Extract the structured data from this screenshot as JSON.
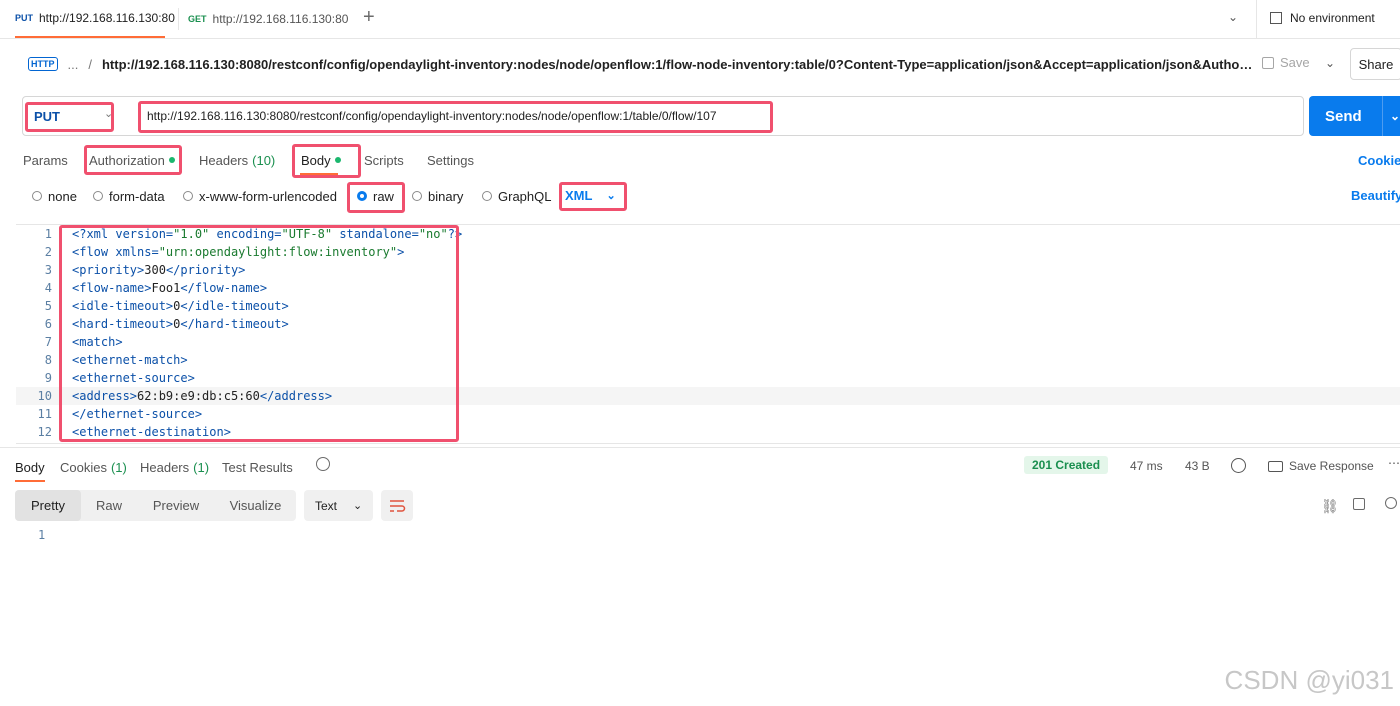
{
  "tabs": [
    {
      "method": "PUT",
      "url": "http://192.168.116.130:80"
    },
    {
      "method": "GET",
      "url": "http://192.168.116.130:80"
    }
  ],
  "environment": "No environment",
  "request_title": "http://192.168.116.130:8080/restconf/config/opendaylight-inventory:nodes/node/openflow:1/flow-node-inventory:table/0?Content-Type=application/json&Accept=application/json&Autho…",
  "breadcrumb_dots": "...",
  "breadcrumb_sep": "/",
  "http_badge": "HTTP",
  "save_label": "Save",
  "share_label": "Share",
  "method": "PUT",
  "url": "http://192.168.116.130:8080/restconf/config/opendaylight-inventory:nodes/node/openflow:1/table/0/flow/107",
  "send_label": "Send",
  "subtabs": {
    "params": "Params",
    "authorization": "Authorization",
    "headers": "Headers",
    "headers_count": "(10)",
    "body": "Body",
    "scripts": "Scripts",
    "settings": "Settings",
    "cookies": "Cookies"
  },
  "body_types": {
    "none": "none",
    "form_data": "form-data",
    "urlencoded": "x-www-form-urlencoded",
    "raw": "raw",
    "binary": "binary",
    "graphql": "GraphQL"
  },
  "raw_format": "XML",
  "beautify": "Beautify",
  "code_lines": [
    {
      "n": "1",
      "t": "<?xml version=\"1.0\" encoding=\"UTF-8\" standalone=\"no\"?>"
    },
    {
      "n": "2",
      "t": "<flow xmlns=\"urn:opendaylight:flow:inventory\">"
    },
    {
      "n": "3",
      "t": "<priority>300</priority>"
    },
    {
      "n": "4",
      "t": "<flow-name>Foo1</flow-name>"
    },
    {
      "n": "5",
      "t": "<idle-timeout>0</idle-timeout>"
    },
    {
      "n": "6",
      "t": "<hard-timeout>0</hard-timeout>"
    },
    {
      "n": "7",
      "t": "<match>"
    },
    {
      "n": "8",
      "t": "<ethernet-match>"
    },
    {
      "n": "9",
      "t": "<ethernet-source>"
    },
    {
      "n": "10",
      "t": "<address>62:b9:e9:db:c5:60</address>"
    },
    {
      "n": "11",
      "t": "</ethernet-source>"
    },
    {
      "n": "12",
      "t": "<ethernet-destination>"
    }
  ],
  "response": {
    "tabs": {
      "body": "Body",
      "cookies": "Cookies",
      "cookies_count": "(1)",
      "headers": "Headers",
      "headers_count": "(1)",
      "test_results": "Test Results"
    },
    "status": "201 Created",
    "time": "47 ms",
    "size": "43 B",
    "save_response": "Save Response",
    "views": [
      "Pretty",
      "Raw",
      "Preview",
      "Visualize"
    ],
    "format": "Text",
    "line_no": "1"
  },
  "watermark": "CSDN @yi031"
}
